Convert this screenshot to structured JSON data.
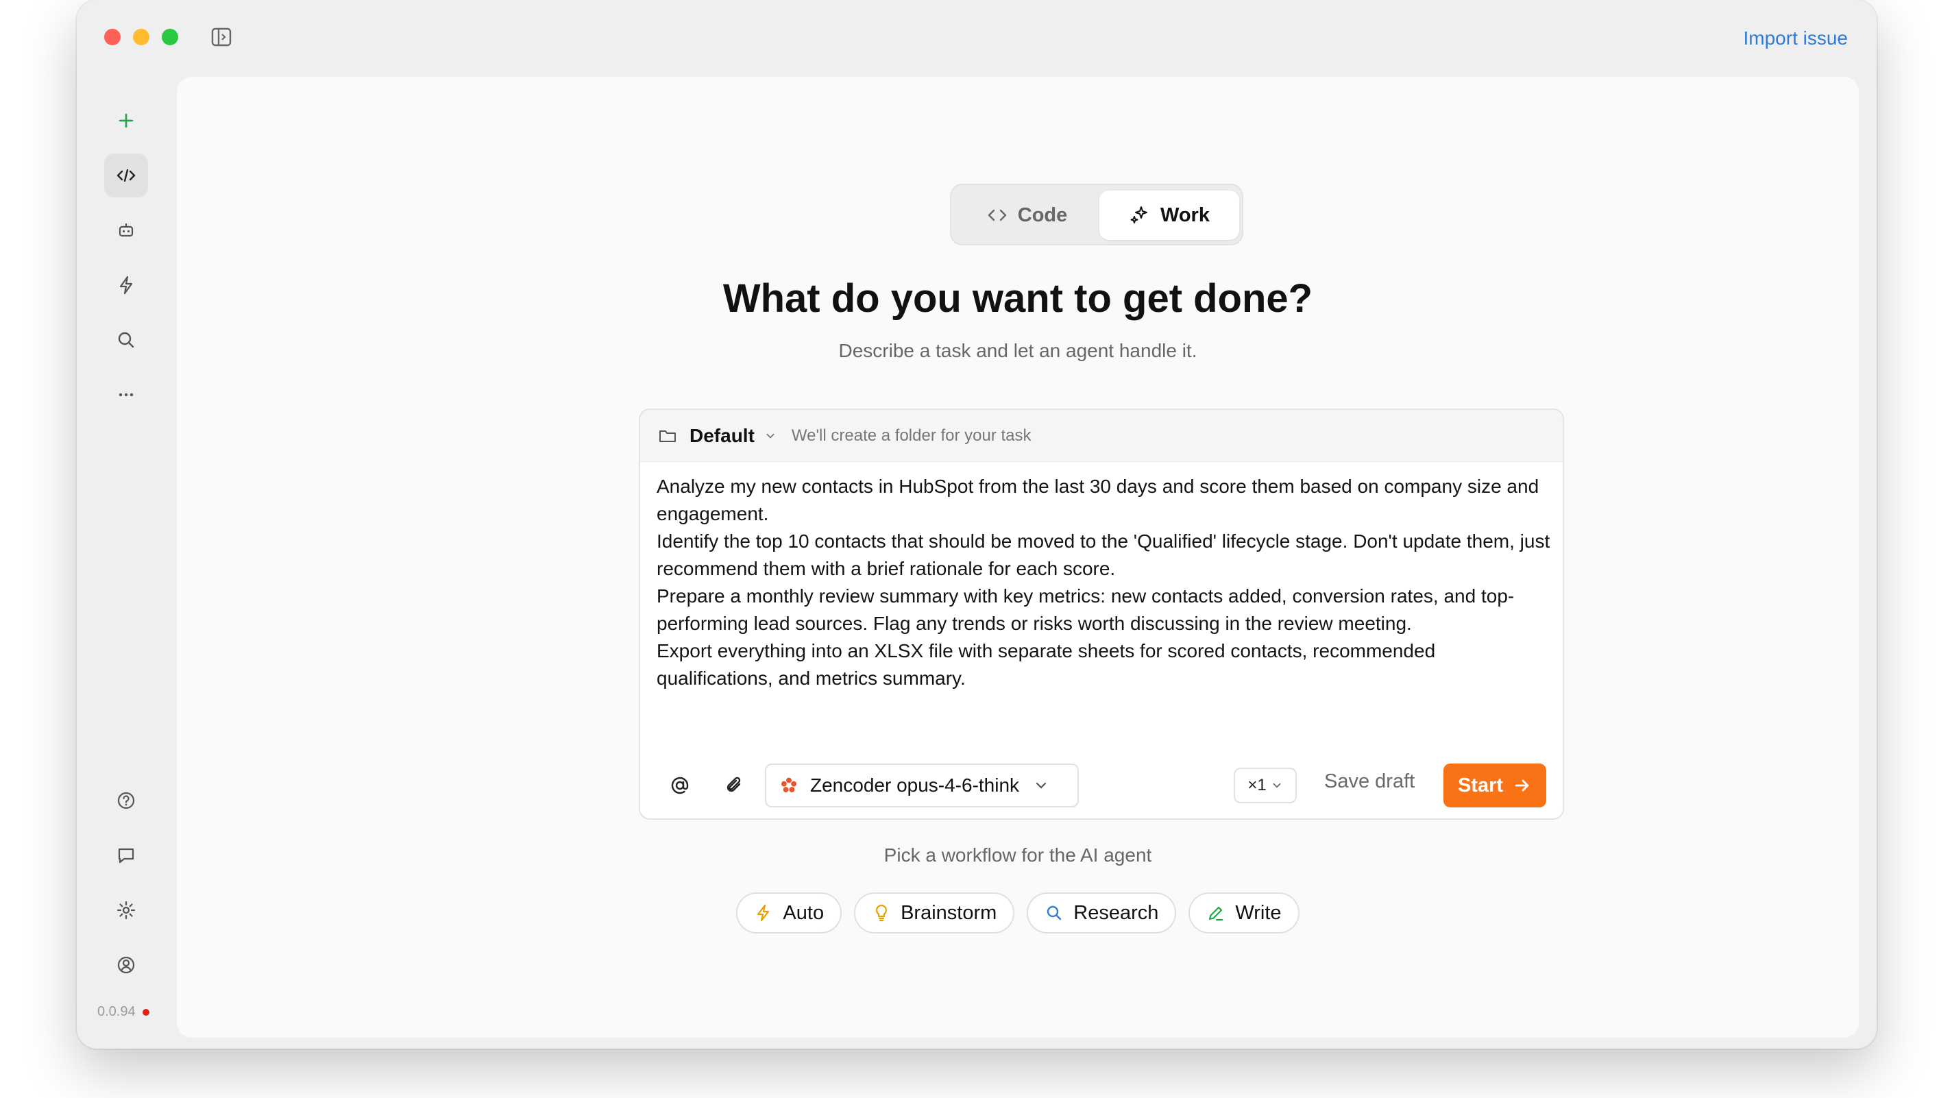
{
  "window": {
    "import_label": "Import issue",
    "version": "0.0.94"
  },
  "rail": {
    "items": [
      {
        "name": "new-task",
        "icon": "plus-icon"
      },
      {
        "name": "code",
        "icon": "code-icon"
      },
      {
        "name": "agents",
        "icon": "robot-icon"
      },
      {
        "name": "automations",
        "icon": "lightning-icon"
      },
      {
        "name": "search",
        "icon": "search-icon"
      },
      {
        "name": "more",
        "icon": "ellipsis-icon"
      }
    ],
    "bottom_items": [
      {
        "name": "help",
        "icon": "help-circle-icon"
      },
      {
        "name": "feedback",
        "icon": "chat-bubble-icon"
      },
      {
        "name": "settings",
        "icon": "gear-icon"
      },
      {
        "name": "account",
        "icon": "user-circle-icon"
      }
    ]
  },
  "mode": {
    "code_label": "Code",
    "work_label": "Work",
    "selected": "Work"
  },
  "hero": {
    "title": "What do you want to get done?",
    "subtitle": "Describe a task and let an agent handle it."
  },
  "composer": {
    "folder_name": "Default",
    "folder_hint": "We'll create a folder for your task",
    "lines": [
      "Analyze my new contacts in HubSpot from the last 30 days and score them based on company size and engagement.",
      "Identify the top 10 contacts that should be moved to the 'Qualified' lifecycle stage. Don't update them, just recommend them with a brief rationale for each score.",
      "Prepare a monthly review summary with key metrics: new contacts added, conversion rates, and top-performing lead sources. Flag any trends or risks worth discussing in the review meeting.",
      "Export everything into an XLSX file with separate sheets for scored contacts, recommended qualifications, and metrics summary."
    ],
    "model": "Zencoder opus-4-6-think",
    "count": "×1",
    "save_draft_label": "Save draft",
    "start_label": "Start"
  },
  "workflow": {
    "label": "Pick a workflow for the AI agent",
    "chips": [
      {
        "label": "Auto",
        "icon": "lightning-icon"
      },
      {
        "label": "Brainstorm",
        "icon": "lightbulb-icon"
      },
      {
        "label": "Research",
        "icon": "search-icon"
      },
      {
        "label": "Write",
        "icon": "pen-icon"
      }
    ]
  },
  "colors": {
    "accent": "#f97316",
    "link": "#2f7bd8",
    "plus": "#22a447",
    "status_dot": "#e0241b"
  }
}
